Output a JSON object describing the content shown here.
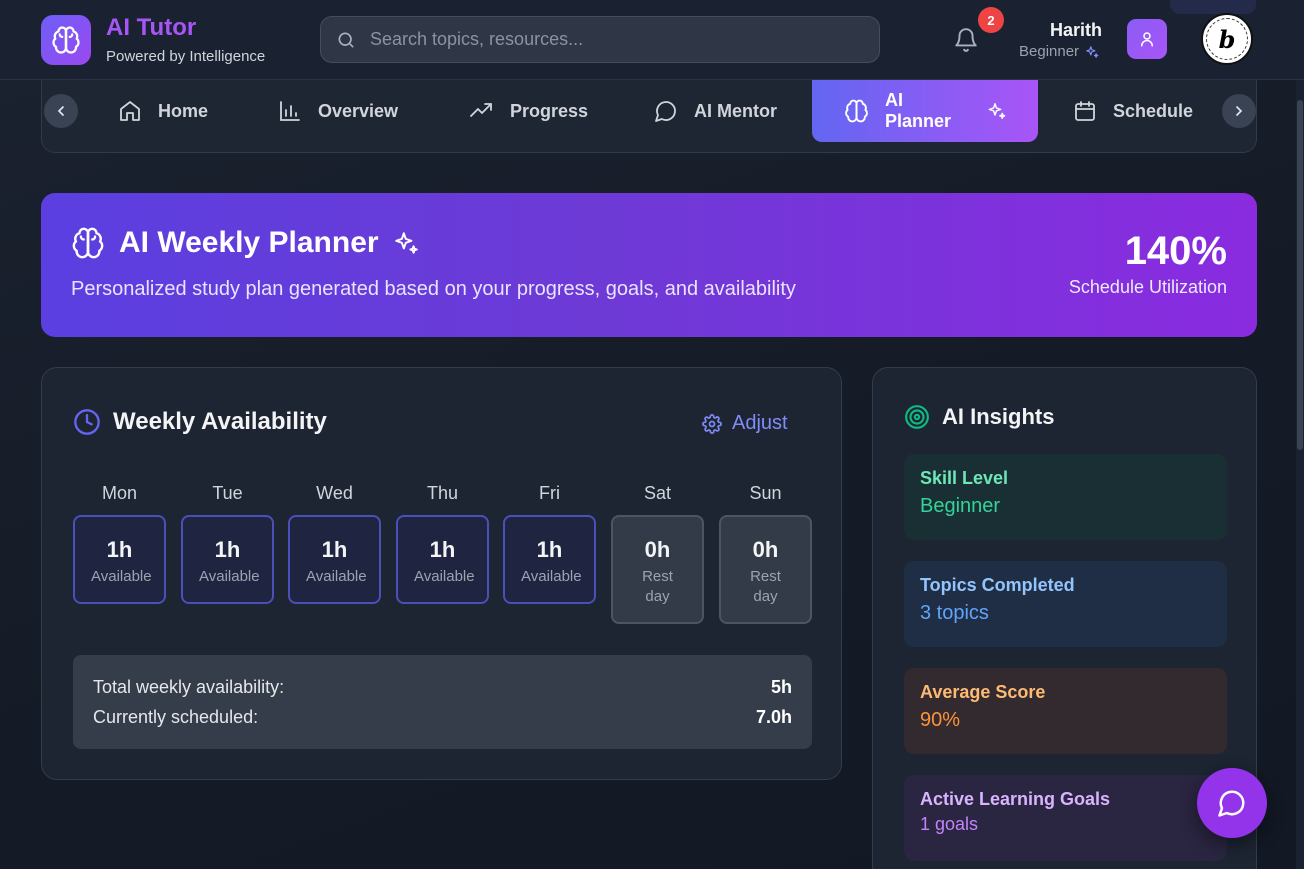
{
  "header": {
    "app_title": "AI Tutor",
    "app_subtitle": "Powered by Intelligence",
    "search_placeholder": "Search topics, resources...",
    "notification_count": "2",
    "user_name": "Harith",
    "user_level": "Beginner",
    "bolt_badge": "b"
  },
  "nav": {
    "items": [
      {
        "label": "Home",
        "icon": "home-icon"
      },
      {
        "label": "Overview",
        "icon": "bar-chart-icon"
      },
      {
        "label": "Progress",
        "icon": "trending-up-icon"
      },
      {
        "label": "AI Mentor",
        "icon": "message-circle-icon"
      },
      {
        "label": "AI Planner",
        "icon": "brain-icon",
        "active": true
      },
      {
        "label": "Schedule",
        "icon": "calendar-icon"
      }
    ]
  },
  "banner": {
    "title": "AI Weekly Planner",
    "subtitle": "Personalized study plan generated based on your progress, goals, and availability",
    "utilization_value": "140%",
    "utilization_label": "Schedule Utilization"
  },
  "availability": {
    "title": "Weekly Availability",
    "adjust_label": "Adjust",
    "days": [
      {
        "day": "Mon",
        "hours": "1h",
        "status": "Available"
      },
      {
        "day": "Tue",
        "hours": "1h",
        "status": "Available"
      },
      {
        "day": "Wed",
        "hours": "1h",
        "status": "Available"
      },
      {
        "day": "Thu",
        "hours": "1h",
        "status": "Available"
      },
      {
        "day": "Fri",
        "hours": "1h",
        "status": "Available"
      },
      {
        "day": "Sat",
        "hours": "0h",
        "status": "Rest day"
      },
      {
        "day": "Sun",
        "hours": "0h",
        "status": "Rest day"
      }
    ],
    "total_label": "Total weekly availability:",
    "total_value": "5h",
    "scheduled_label": "Currently scheduled:",
    "scheduled_value": "7.0h"
  },
  "insights": {
    "title": "AI Insights",
    "tiles": [
      {
        "label": "Skill Level",
        "value": "Beginner"
      },
      {
        "label": "Topics Completed",
        "value": "3 topics"
      },
      {
        "label": "Average Score",
        "value": "90%"
      },
      {
        "label": "Active Learning Goals",
        "value": "1 goals"
      }
    ]
  },
  "colors": {
    "accent": "#a855f7",
    "indigo": "#6366f1",
    "skill_green": "#34d399",
    "topics_blue": "#60a5fa",
    "score_orange": "#fb923c",
    "goals_purple": "#c084fc"
  }
}
